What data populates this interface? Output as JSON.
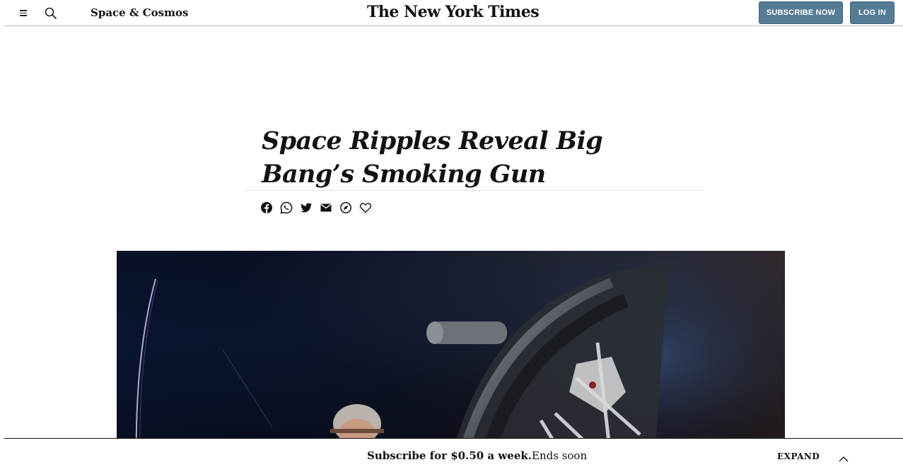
{
  "header": {
    "section": "Space & Cosmos",
    "logo": "The New York Times",
    "subscribe_label": "SUBSCRIBE NOW",
    "login_label": "LOG IN",
    "menu_icon": "hamburger-menu-icon",
    "search_icon": "search-icon",
    "button_color": "#567b95"
  },
  "article": {
    "headline": "Space Ripples Reveal Big Bang’s Smoking Gun",
    "share_icons": [
      "facebook-icon",
      "whatsapp-icon",
      "twitter-icon",
      "email-icon",
      "explore-icon",
      "heart-icon"
    ]
  },
  "footer": {
    "offer_bold": "Subscribe for $0.50 a week.",
    "offer_rest": "Ends soon",
    "expand_label": "EXPAND",
    "expand_icon": "chevron-up-icon"
  }
}
